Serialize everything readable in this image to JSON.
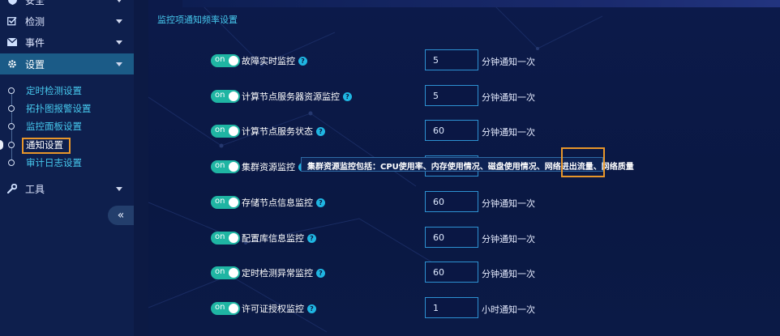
{
  "sidebar": {
    "items": [
      {
        "label": "安全",
        "icon": "shield-icon"
      },
      {
        "label": "检测",
        "icon": "checkbox-icon"
      },
      {
        "label": "事件",
        "icon": "envelope-icon"
      },
      {
        "label": "设置",
        "icon": "gear-icon",
        "active": true
      },
      {
        "label": "工具",
        "icon": "wrench-icon"
      }
    ],
    "sub_items": [
      {
        "label": "定时检测设置"
      },
      {
        "label": "拓扑图报警设置"
      },
      {
        "label": "监控面板设置"
      },
      {
        "label": "通知设置",
        "current": true
      },
      {
        "label": "审计日志设置"
      }
    ],
    "collapse_icon": "«"
  },
  "main": {
    "title": "监控项通知频率设置",
    "toggle_label": "on",
    "help_icon": "?",
    "rows": [
      {
        "label": "故障实时监控",
        "value": "5",
        "unit": "分钟通知一次"
      },
      {
        "label": "计算节点服务器资源监控",
        "value": "5",
        "unit": "分钟通知一次"
      },
      {
        "label": "计算节点服务状态",
        "value": "60",
        "unit": "分钟通知一次"
      },
      {
        "label": "集群资源监控",
        "value": "",
        "unit": ""
      },
      {
        "label": "存储节点信息监控",
        "value": "60",
        "unit": "分钟通知一次"
      },
      {
        "label": "配置库信息监控",
        "value": "60",
        "unit": "分钟通知一次"
      },
      {
        "label": "定时检测异常监控",
        "value": "60",
        "unit": "分钟通知一次"
      },
      {
        "label": "许可证授权监控",
        "value": "1",
        "unit": "小时通知一次"
      }
    ],
    "tooltip": "集群资源监控包括：CPU使用率、内存使用情况、磁盘使用情况、网络进出流量、网络质量"
  },
  "colors": {
    "accent": "#47c9ee",
    "toggle_on": "#1fb5a3",
    "highlight": "#e8962a",
    "sidebar_active": "#1b5b87"
  }
}
